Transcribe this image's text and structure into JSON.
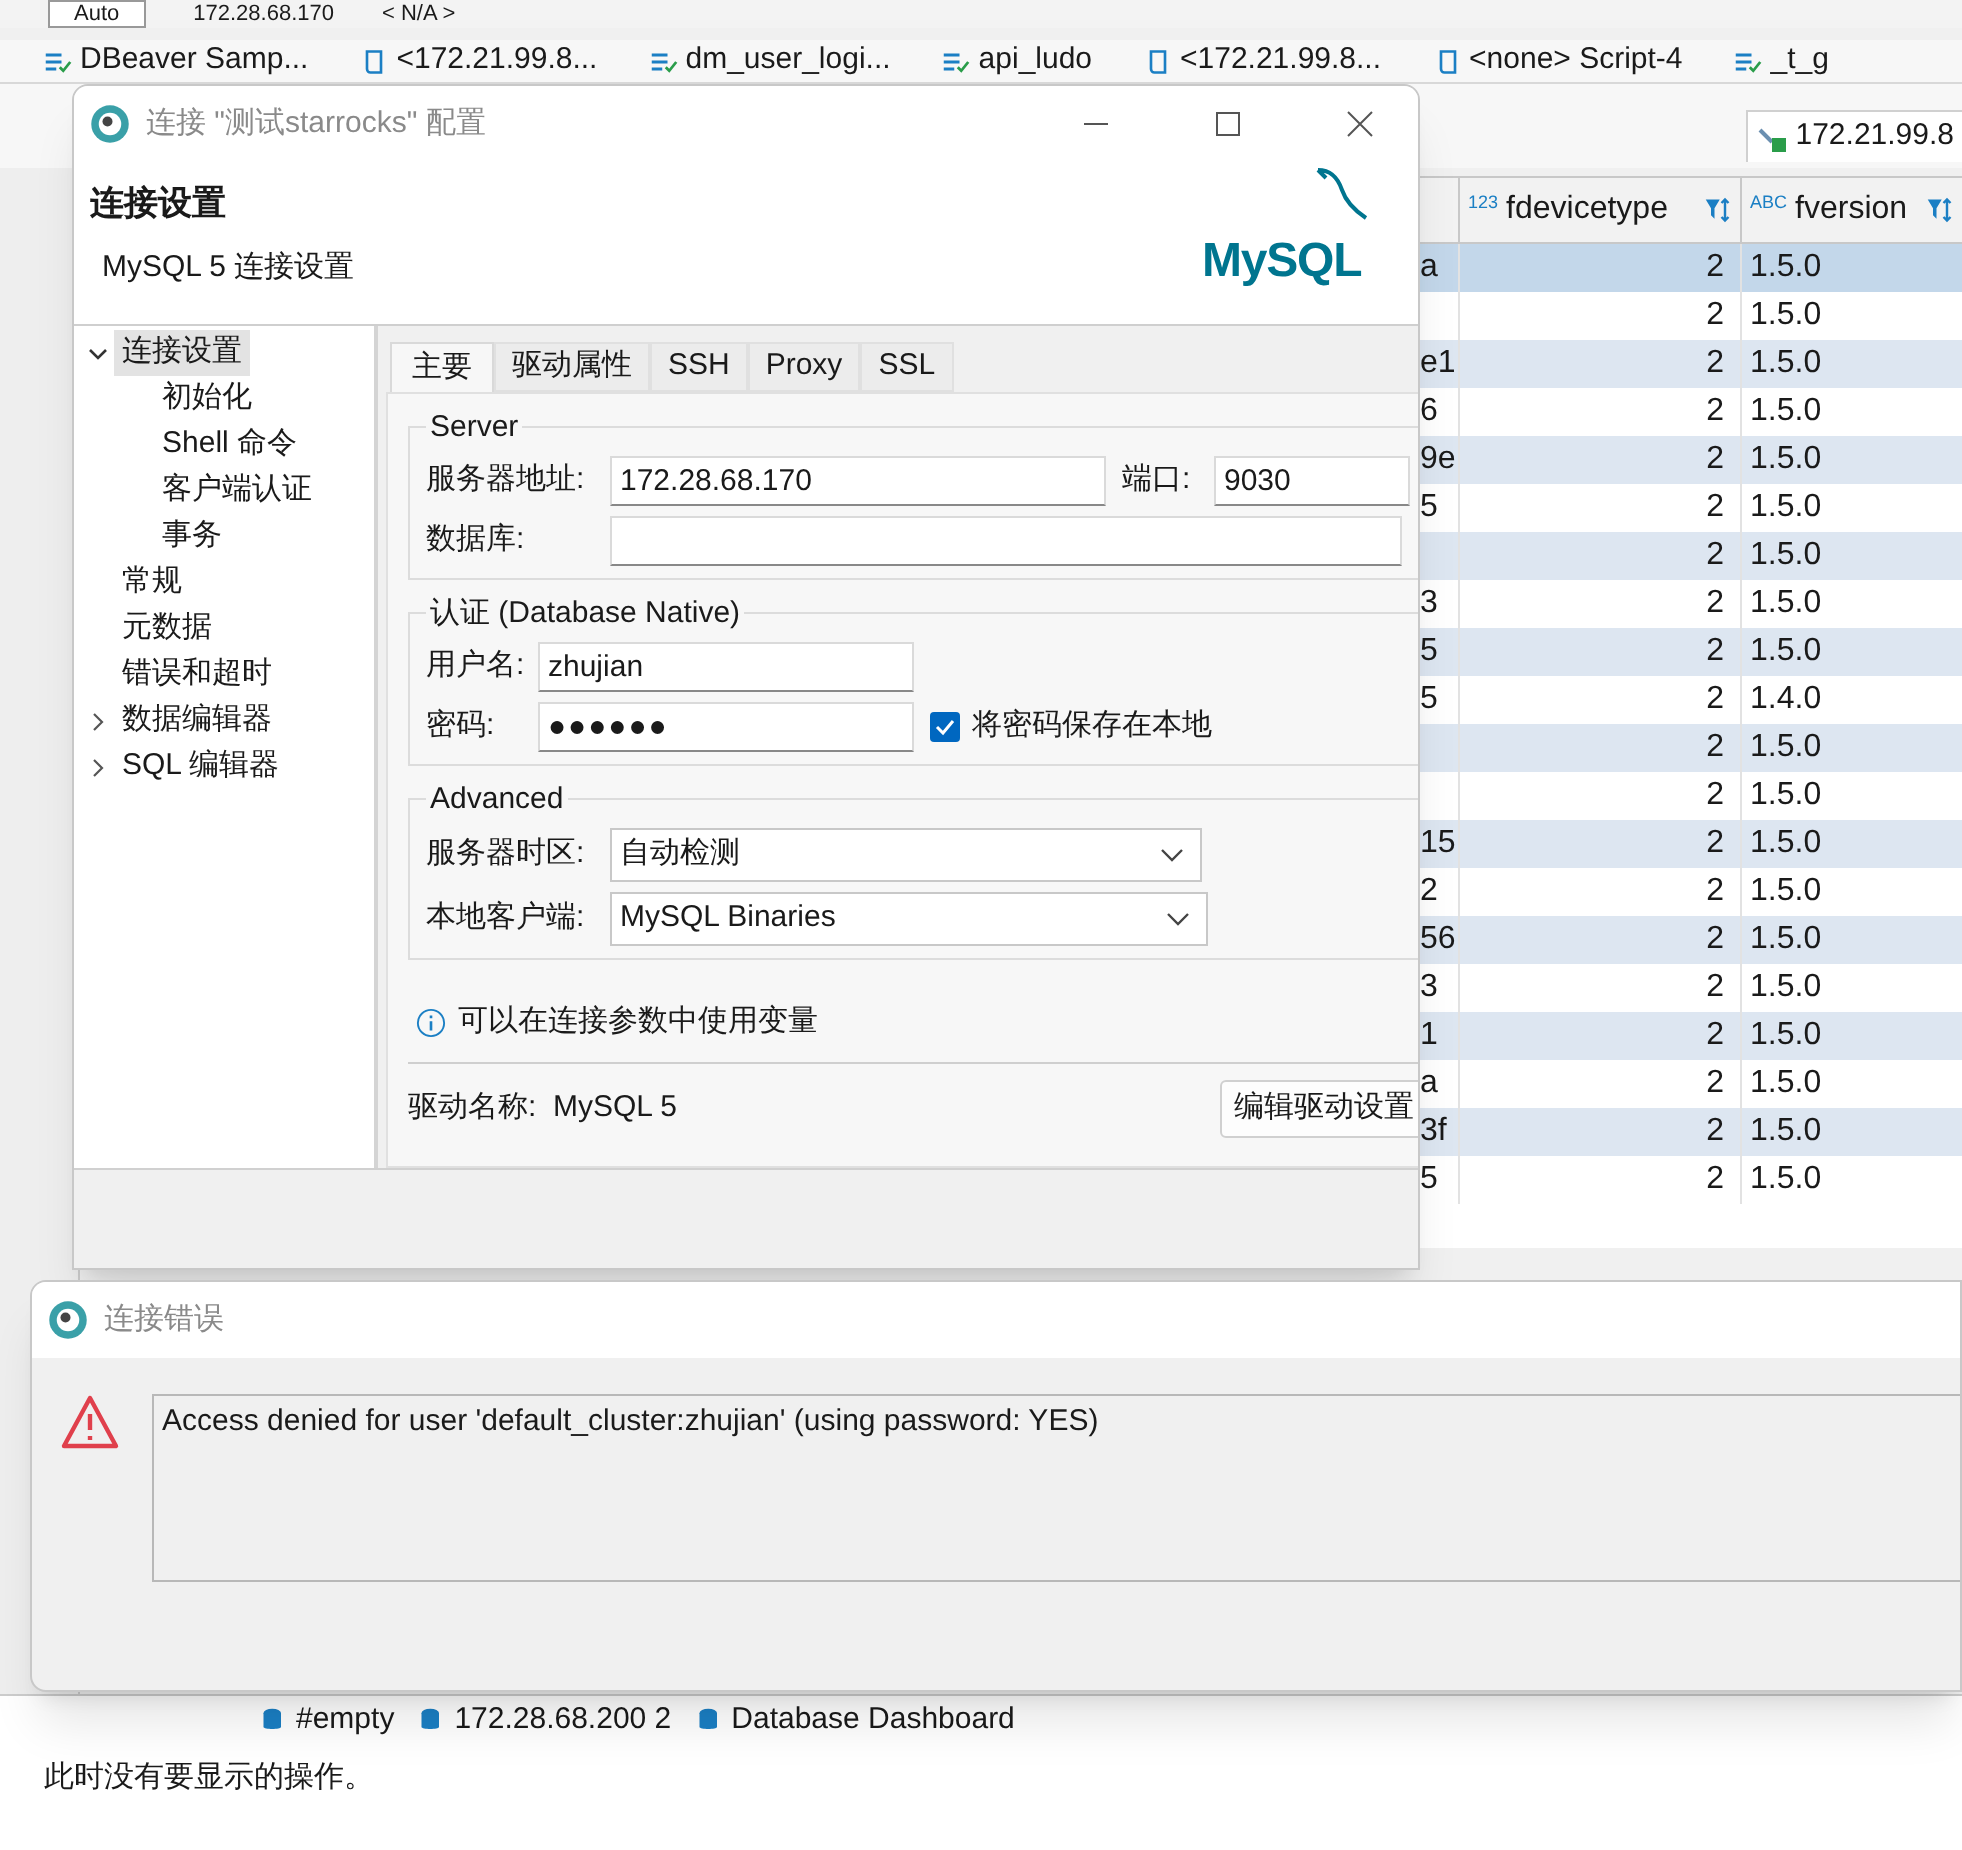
{
  "toolbar": {
    "items": [
      "Auto",
      "172.28.68.170",
      "< N/A >"
    ]
  },
  "editor_tabs": [
    {
      "label": "DBeaver Samp...",
      "kind": "table"
    },
    {
      "label": "<172.21.99.8...",
      "kind": "script"
    },
    {
      "label": "dm_user_logi...",
      "kind": "table"
    },
    {
      "label": "api_ludo",
      "kind": "table"
    },
    {
      "label": "<172.21.99.8...",
      "kind": "script"
    },
    {
      "label": "<none> Script-4",
      "kind": "script"
    },
    {
      "label": "_t_g",
      "kind": "table"
    }
  ],
  "connection_tab": {
    "label": "172.21.99.8"
  },
  "table": {
    "columns": [
      {
        "label": "fdevicetype",
        "type_badge": "123"
      },
      {
        "label": "fversion",
        "type_badge": "ABC"
      }
    ],
    "rows": [
      {
        "column_1": "a",
        "fdevicetype": "2",
        "fversion": "1.5.0",
        "selected": true
      },
      {
        "fdevicetype": "2",
        "fversion": "1.5.0",
        "selected": false
      },
      {
        "column_1": "e1",
        "fdevicetype": "2",
        "fversion": "1.5.0",
        "selected": false
      },
      {
        "column_1": "6",
        "fdevicetype": "2",
        "fversion": "1.5.0",
        "selected": false
      },
      {
        "column_1": "9e",
        "fdevicetype": "2",
        "fversion": "1.5.0",
        "selected": false
      },
      {
        "column_1": "5",
        "fdevicetype": "2",
        "fversion": "1.5.0",
        "selected": false
      },
      {
        "fdevicetype": "2",
        "fversion": "1.5.0",
        "selected": false
      },
      {
        "column_1": "3",
        "fdevicetype": "2",
        "fversion": "1.5.0",
        "selected": false
      },
      {
        "column_1": "5",
        "fdevicetype": "2",
        "fversion": "1.5.0",
        "selected": false
      },
      {
        "column_1": "5",
        "fdevicetype": "2",
        "fversion": "1.4.0",
        "selected": false
      },
      {
        "fdevicetype": "2",
        "fversion": "1.5.0",
        "selected": false
      },
      {
        "fdevicetype": "2",
        "fversion": "1.5.0",
        "selected": false
      },
      {
        "column_1": "15",
        "fdevicetype": "2",
        "fversion": "1.5.0",
        "selected": false
      },
      {
        "column_1": "2",
        "fdevicetype": "2",
        "fversion": "1.5.0",
        "selected": false
      },
      {
        "column_1": "56",
        "fdevicetype": "2",
        "fversion": "1.5.0",
        "selected": false
      },
      {
        "column_1": "3",
        "fdevicetype": "2",
        "fversion": "1.5.0",
        "selected": false
      },
      {
        "column_1": "1",
        "fdevicetype": "2",
        "fversion": "1.5.0",
        "selected": false
      },
      {
        "column_1": "a",
        "fdevicetype": "2",
        "fversion": "1.5.0",
        "selected": false
      },
      {
        "column_1": "3f",
        "fdevicetype": "2",
        "fversion": "1.5.0",
        "selected": false
      },
      {
        "column_1": "5",
        "fdevicetype": "2",
        "fversion": "1.5.0",
        "selected": false
      }
    ]
  },
  "connection_dialog": {
    "title": "连接 \"测试starrocks\" 配置",
    "heading": "连接设置",
    "subheading": "MySQL 5 连接设置",
    "logo_text": "MySQL",
    "tree": [
      {
        "label": "连接设置",
        "selected": true,
        "expanded": true,
        "children": [
          {
            "label": "初始化",
            "selected": false
          },
          {
            "label": "Shell 命令",
            "selected": false
          },
          {
            "label": "客户端认证",
            "selected": false
          },
          {
            "label": "事务",
            "selected": false
          }
        ]
      },
      {
        "label": "常规",
        "selected": false
      },
      {
        "label": "元数据",
        "selected": false
      },
      {
        "label": "错误和超时",
        "selected": false
      },
      {
        "label": "数据编辑器",
        "selected": false,
        "expanded": false
      },
      {
        "label": "SQL 编辑器",
        "selected": false,
        "expanded": false
      }
    ],
    "tabs": [
      {
        "label": "主要",
        "selected": true
      },
      {
        "label": "驱动属性",
        "selected": false
      },
      {
        "label": "SSH",
        "selected": false
      },
      {
        "label": "Proxy",
        "selected": false
      },
      {
        "label": "SSL",
        "selected": false
      }
    ],
    "server": {
      "title": "Server",
      "host_label": "服务器地址:",
      "host": "172.28.68.170",
      "port_label": "端口:",
      "port": "9030",
      "database_label": "数据库:"
    },
    "auth": {
      "title": "认证 (Database Native)",
      "user_label": "用户名:",
      "user": "zhujian",
      "password_label": "密码:",
      "password": "●●●●●●",
      "save_password": {
        "label": "将密码保存在本地",
        "checked": true
      }
    },
    "advanced": {
      "title": "Advanced",
      "timezone_label": "服务器时区:",
      "timezone": "自动检测",
      "client_label": "本地客户端:",
      "client": "MySQL Binaries"
    },
    "info": "可以在连接参数中使用变量",
    "driver_label": "驱动名称:",
    "driver": "MySQL 5",
    "edit_driver_button": "编辑驱动设置"
  },
  "error_dialog": {
    "title": "连接错误",
    "message": "Access denied for user 'default_cluster:zhujian' (using password: YES)"
  },
  "bottom_panel": {
    "tabs": [
      "#empty",
      "172.28.68.200 2",
      "Database Dashboard"
    ],
    "message": "此时没有要显示的操作。"
  }
}
